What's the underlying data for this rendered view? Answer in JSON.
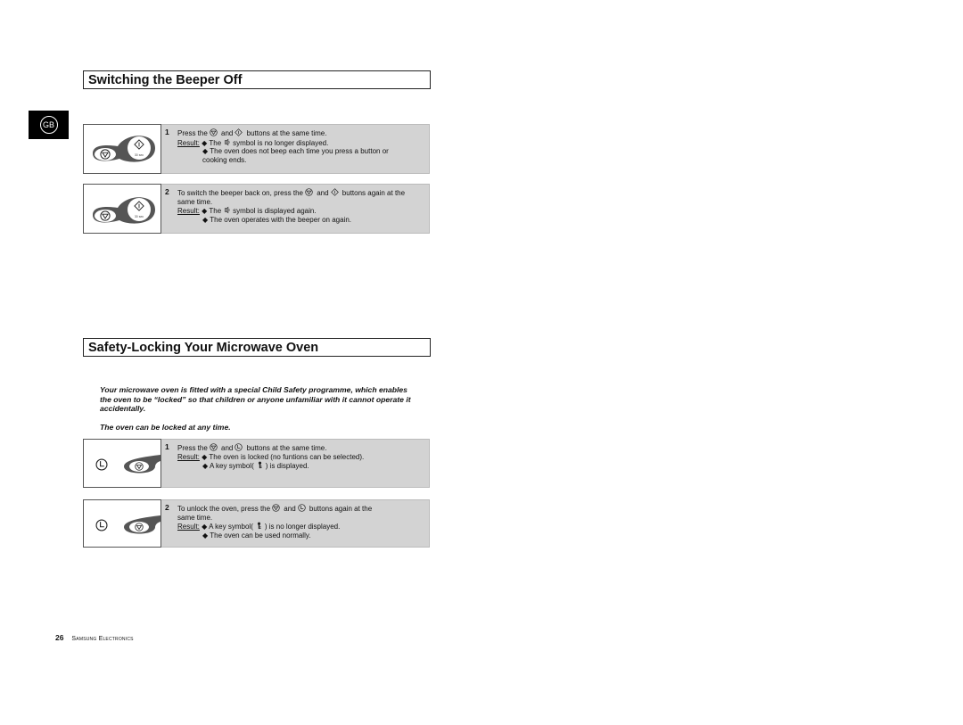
{
  "language_tab": "GB",
  "sections": [
    {
      "title": "Switching the Beeper Off",
      "steps": [
        {
          "number": "1",
          "instruction_pre": "Press the",
          "instruction_mid": "and",
          "instruction_post": "buttons at the same time.",
          "result_label": "Result:",
          "results": [
            "The",
            "symbol is no longer displayed.",
            "The oven does not beep each time you press a button or",
            "cooking ends."
          ],
          "illustration_label": "30 sec"
        },
        {
          "number": "2",
          "instruction_pre": "To switch the beeper back on, press the",
          "instruction_mid": "and",
          "instruction_post": "buttons again at the",
          "instruction_cont": "same time.",
          "result_label": "Result:",
          "results": [
            "The",
            "symbol is displayed again.",
            "The oven operates with the beeper on again."
          ],
          "illustration_label": "30 sec"
        }
      ]
    },
    {
      "title": "Safety-Locking Your Microwave Oven",
      "intro": "Your microwave oven is fitted with a special Child Safety programme, which enables the oven to be “locked” so that children or anyone unfamiliar with it cannot operate it accidentally.",
      "note": "The oven can be locked at any time.",
      "steps": [
        {
          "number": "1",
          "instruction_pre": "Press the",
          "instruction_mid": "and",
          "instruction_post": "buttons at the same time.",
          "result_label": "Result:",
          "results": [
            "The oven is locked (no funtions can be selected).",
            "A key symbol(",
            ") is displayed."
          ]
        },
        {
          "number": "2",
          "instruction_pre": "To unlock the oven, press the",
          "instruction_mid": "and",
          "instruction_post": "buttons again at the",
          "instruction_cont": "same time.",
          "result_label": "Result:",
          "results": [
            "A key symbol(",
            ") is no longer displayed.",
            "The oven can be used normally."
          ]
        }
      ]
    }
  ],
  "footer": {
    "page_number": "26",
    "company": "Samsung Electronics"
  },
  "icons": {
    "stop": "stop-button-icon",
    "start": "start-button-icon",
    "clock": "clock-button-icon",
    "beep": "beeper-symbol-icon",
    "key": "key-symbol-icon",
    "bullet": "◆"
  }
}
